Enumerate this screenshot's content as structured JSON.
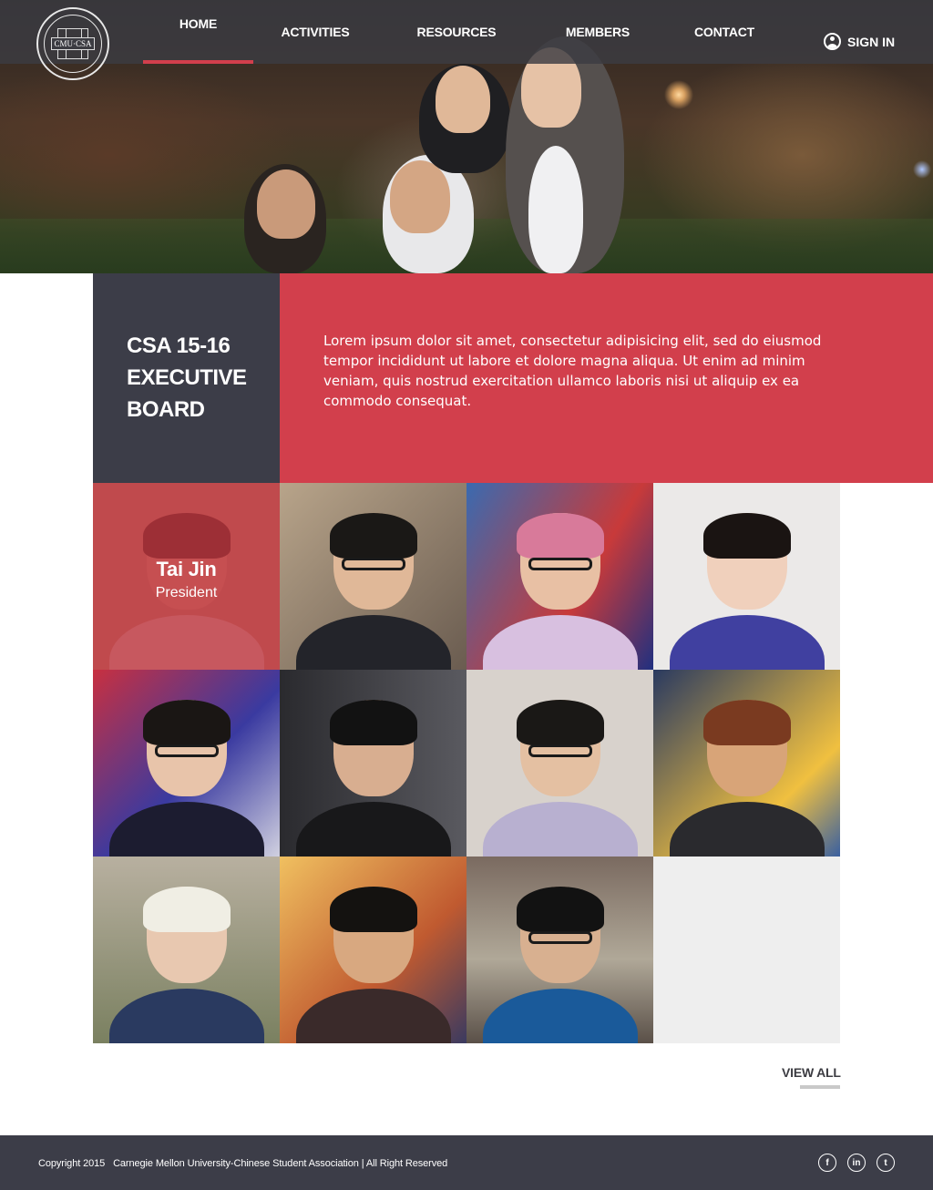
{
  "header": {
    "logo_text": "CMU·CSA",
    "nav": [
      {
        "label": "HOME",
        "active": true
      },
      {
        "label": "ACTIVITIES",
        "active": false
      },
      {
        "label": "RESOURCES",
        "active": false
      },
      {
        "label": "MEMBERS",
        "active": false
      },
      {
        "label": "CONTACT",
        "active": false
      }
    ],
    "sign_in": "SIGN IN"
  },
  "board": {
    "title_lines": [
      "CSA 15-16",
      "EXECUTIVE",
      "BOARD"
    ],
    "description": "Lorem ipsum dolor sit amet, consectetur adipisicing elit, sed do eiusmod tempor incididunt ut labore et dolore magna aliqua. Ut enim ad minim veniam, quis nostrud exercitation ullamco laboris nisi ut aliquip ex ea commodo consequat."
  },
  "members": {
    "featured": {
      "name": "Tai Jin",
      "role": "President"
    },
    "view_all": "VIEW ALL"
  },
  "footer": {
    "copyright": "Copyright 2015   Carnegie Mellon University-Chinese Student Association | All Right Reserved",
    "social": [
      {
        "icon": "facebook-icon",
        "glyph": "f"
      },
      {
        "icon": "linkedin-icon",
        "glyph": "in"
      },
      {
        "icon": "twitter-icon",
        "glyph": "t"
      }
    ]
  },
  "colors": {
    "accent": "#d23f4c",
    "dark": "#3c3d48"
  }
}
